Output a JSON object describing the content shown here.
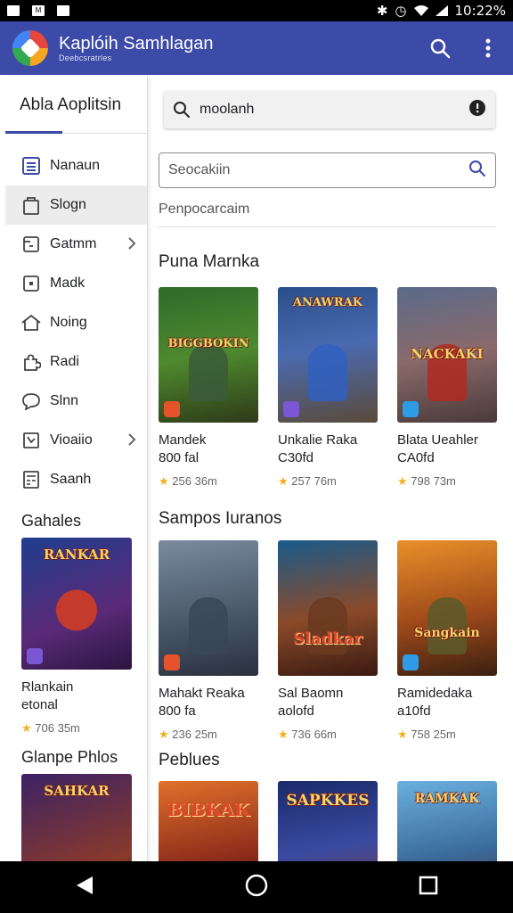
{
  "status": {
    "time": "10:22%"
  },
  "appbar": {
    "title": "Kaplóih Samhlagan",
    "subtitle": "Deebcsratrles"
  },
  "sidebar": {
    "header": "Abla Aoplitsin",
    "items": [
      {
        "label": "Nanaun",
        "icon": "grid-icon"
      },
      {
        "label": "Slogn",
        "icon": "bag-icon"
      },
      {
        "label": "Gatmm",
        "icon": "box-icon"
      },
      {
        "label": "Madk",
        "icon": "square-icon"
      },
      {
        "label": "Noing",
        "icon": "home-icon"
      },
      {
        "label": "Radi",
        "icon": "puzzle-icon"
      },
      {
        "label": "Slnn",
        "icon": "chat-icon"
      },
      {
        "label": "Vioaiio",
        "icon": "chart-icon"
      },
      {
        "label": "Saanh",
        "icon": "calculator-icon"
      }
    ],
    "section1": "Gahales",
    "card1": {
      "art_text": "RANKAR",
      "name": "Rlankain",
      "sub": "etonal",
      "rating": "706 35m"
    },
    "section2": "Glanpe Phlos",
    "card2": {
      "art_text": "SAHKAR"
    }
  },
  "main": {
    "search_top": "moolanh",
    "search_placeholder": "Seocakiin",
    "hint": "Penpocarcaim",
    "section1": "Puna Marnka",
    "row1": [
      {
        "art_text": "BIGGBOKIN",
        "name": "Mandek",
        "sub": "800 fal",
        "rating": "256 36m",
        "badge": "#e5532d"
      },
      {
        "art_text": "ANAWRAK",
        "name": "Unkalie Raka",
        "sub": "C30fd",
        "rating": "257 76m",
        "badge": "#7b57d6"
      },
      {
        "art_text": "NACKAKI",
        "name": "Blata Ueahler",
        "sub": "CA0fd",
        "rating": "798 73m",
        "badge": "#2e9be5"
      }
    ],
    "section2": "Sampos Iuranos",
    "row2": [
      {
        "art_text": "",
        "name": "Mahakt Reaka",
        "sub": "800 fa",
        "rating": "236 25m",
        "badge": "#e5532d"
      },
      {
        "art_text": "Sladkar",
        "name": "Sal Baomn",
        "sub": "aolofd",
        "rating": "736 66m",
        "badge": ""
      },
      {
        "art_text": "Sangkain",
        "name": "Ramidedaka",
        "sub": "a10fd",
        "rating": "758 25m",
        "badge": "#2e9be5"
      }
    ],
    "section3": "Peblues",
    "row3": [
      {
        "art_text": "BIBKAK"
      },
      {
        "art_text": "SAPKKES"
      },
      {
        "art_text": "RAMKAK"
      }
    ]
  },
  "colors": {
    "appbar": "#3c4aa8",
    "star": "#f2b01e"
  }
}
